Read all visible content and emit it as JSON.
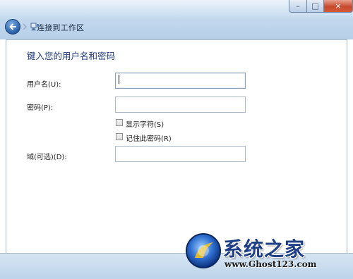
{
  "window": {
    "title": "连接到工作区",
    "controls": {
      "minimize": "–",
      "maximize": "□",
      "close": "×"
    }
  },
  "form": {
    "heading": "键入您的用户名和密码",
    "username_label": "用户名(U):",
    "username_value": "",
    "password_label": "密码(P):",
    "password_value": "",
    "show_chars_label": "显示字符(S)",
    "show_chars_checked": false,
    "remember_label": "记住此密码(R)",
    "remember_checked": false,
    "domain_label": "域(可选)(D):",
    "domain_value": ""
  },
  "watermark": {
    "title": "系统之家",
    "url": "www.Ghost123.com"
  },
  "icons": {
    "back": "back-arrow-icon",
    "forward": "forward-arrow-icon",
    "title": "network-icon",
    "logo": "ghost-logo-icon"
  }
}
